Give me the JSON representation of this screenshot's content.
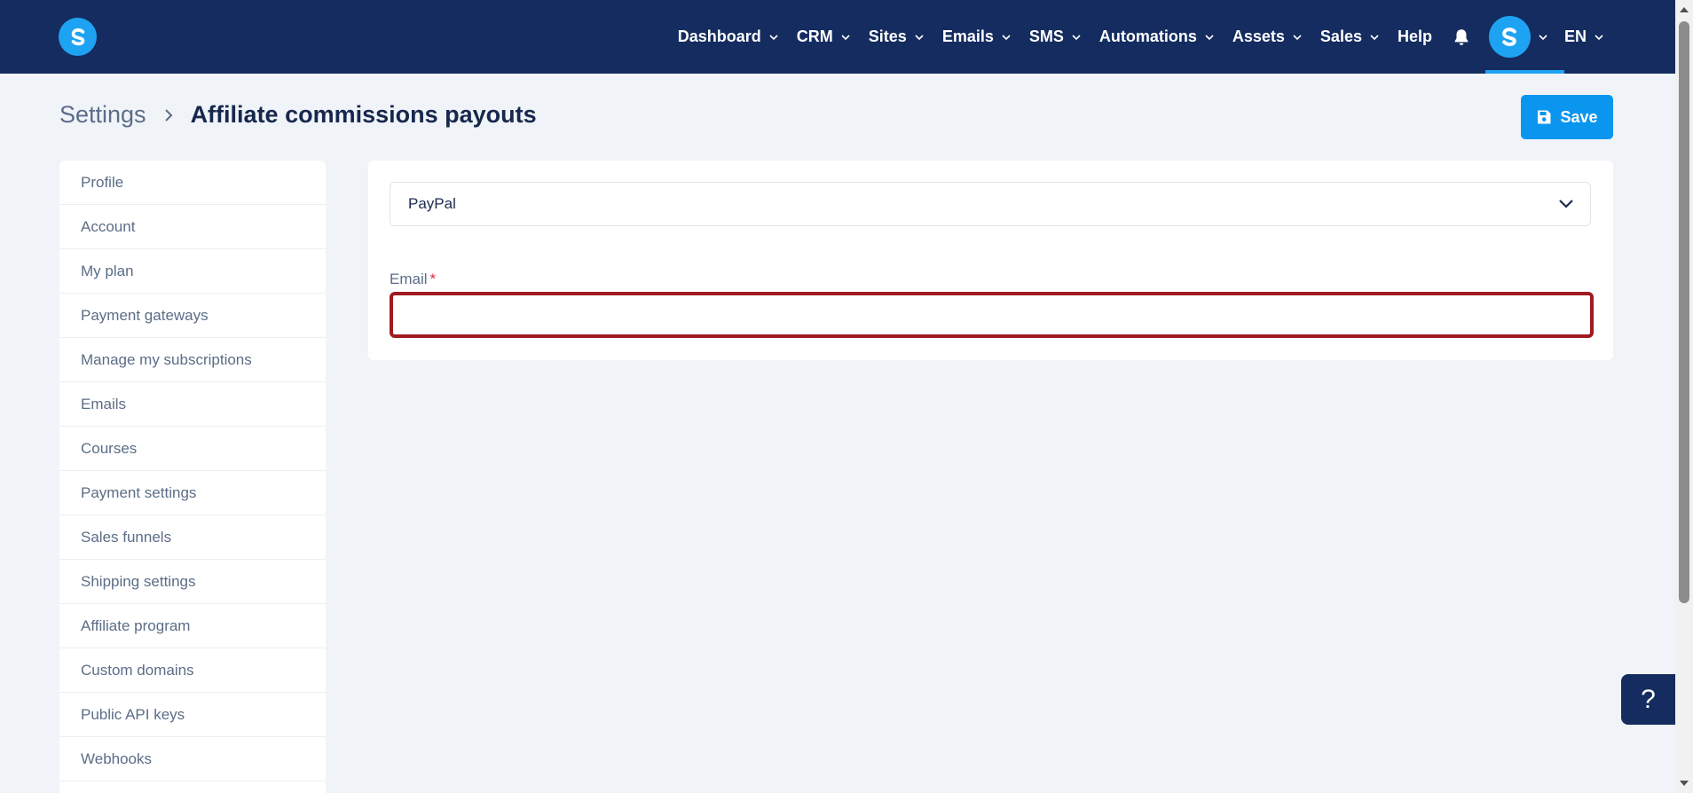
{
  "nav": {
    "items": [
      {
        "label": "Dashboard",
        "dropdown": true
      },
      {
        "label": "CRM",
        "dropdown": true
      },
      {
        "label": "Sites",
        "dropdown": true
      },
      {
        "label": "Emails",
        "dropdown": true
      },
      {
        "label": "SMS",
        "dropdown": true
      },
      {
        "label": "Automations",
        "dropdown": true
      },
      {
        "label": "Assets",
        "dropdown": true
      },
      {
        "label": "Sales",
        "dropdown": true
      }
    ],
    "help_label": "Help",
    "language_label": "EN"
  },
  "header": {
    "breadcrumb_root": "Settings",
    "page_title": "Affiliate commissions payouts",
    "save_label": "Save"
  },
  "sidebar": {
    "items": [
      {
        "label": "Profile"
      },
      {
        "label": "Account"
      },
      {
        "label": "My plan"
      },
      {
        "label": "Payment gateways"
      },
      {
        "label": "Manage my subscriptions"
      },
      {
        "label": "Emails"
      },
      {
        "label": "Courses"
      },
      {
        "label": "Payment settings"
      },
      {
        "label": "Sales funnels"
      },
      {
        "label": "Shipping settings"
      },
      {
        "label": "Affiliate program"
      },
      {
        "label": "Custom domains"
      },
      {
        "label": "Public API keys"
      },
      {
        "label": "Webhooks"
      }
    ]
  },
  "form": {
    "payout_method": "PayPal",
    "email_label": "Email",
    "required_marker": "*",
    "email_value": ""
  },
  "help_button": {
    "label": "?"
  },
  "colors": {
    "topbar": "#142c5f",
    "accent": "#1ea3f2",
    "save_button": "#0a95ef",
    "error_border": "#a01b1f",
    "background": "#f0f4f9"
  }
}
